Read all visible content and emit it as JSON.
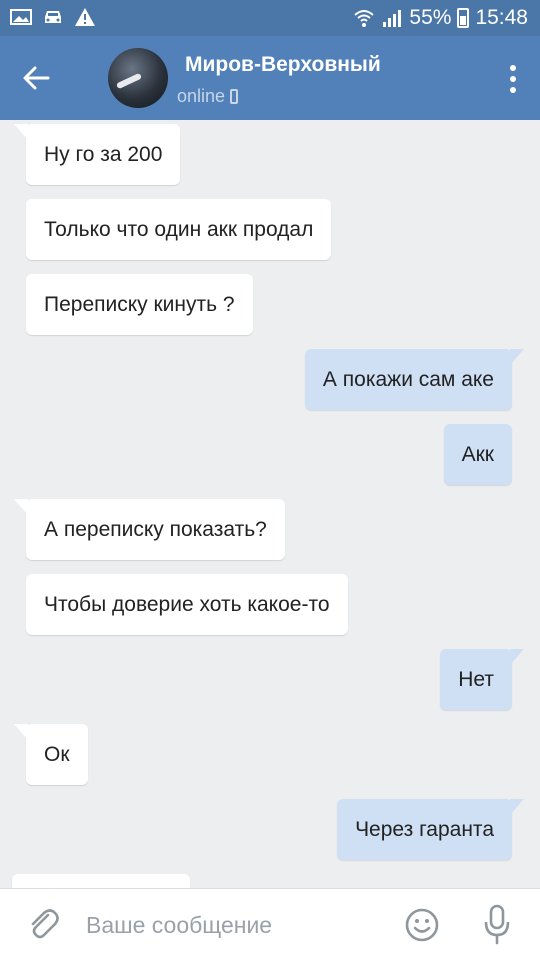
{
  "status_bar": {
    "battery": "55%",
    "time": "15:48"
  },
  "header": {
    "contact_name": "Миров-Верховный",
    "contact_status": "online"
  },
  "messages": [
    {
      "direction": "in",
      "text": "Ну го за 200"
    },
    {
      "direction": "in",
      "text": "Только что один акк продал"
    },
    {
      "direction": "in",
      "text": "Переписку кинуть ?"
    },
    {
      "direction": "out",
      "text": "А покажи сам аке"
    },
    {
      "direction": "out",
      "text": "Акк"
    },
    {
      "direction": "in",
      "text": "А переписку показать?"
    },
    {
      "direction": "in",
      "text": "Чтобы доверие хоть какое-то"
    },
    {
      "direction": "out",
      "text": "Нет"
    },
    {
      "direction": "in",
      "text": "Ок"
    },
    {
      "direction": "out",
      "text": "Через гаранта"
    }
  ],
  "composer": {
    "placeholder": "Ваше сообщение"
  },
  "colors": {
    "header_bg": "#5181b8",
    "status_bar_bg": "#4a76a8",
    "chat_bg": "#edeef0",
    "incoming_bubble": "#ffffff",
    "outgoing_bubble": "#cfe0f5"
  },
  "icons": [
    "image-icon",
    "car-icon",
    "warning-icon",
    "wifi-icon",
    "signal-icon",
    "battery-icon",
    "back-arrow-icon",
    "mobile-phone-icon",
    "more-vertical-icon",
    "paperclip-icon",
    "smile-icon",
    "microphone-icon"
  ]
}
